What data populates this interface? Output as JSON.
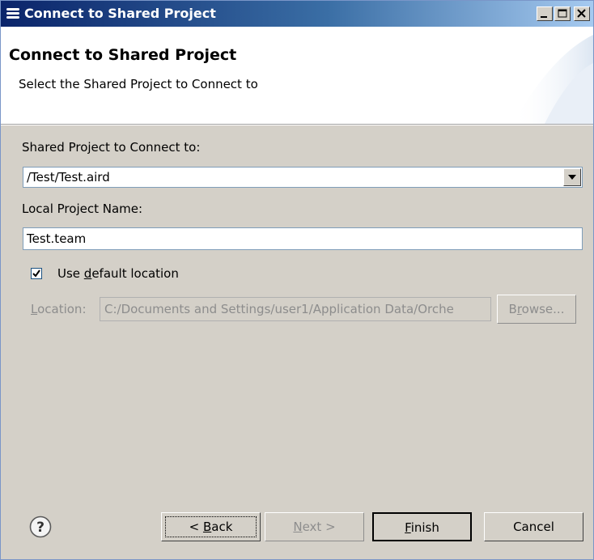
{
  "window": {
    "title": "Connect to Shared Project",
    "icon": "stacked-bars-icon"
  },
  "banner": {
    "title": "Connect to Shared Project",
    "description": "Select the Shared Project to Connect to"
  },
  "form": {
    "shared_project_label": "Shared Project to Connect to:",
    "shared_project_value": "/Test/Test.aird",
    "local_name_label": "Local Project Name:",
    "local_name_value": "Test.team",
    "use_default_checked": true,
    "use_default_pre": "Use ",
    "use_default_mn": "d",
    "use_default_post": "efault location",
    "location_label_mn": "L",
    "location_label_rest": "ocation:",
    "location_value": "C:/Documents and Settings/user1/Application Data/Orche",
    "browse_pre": "B",
    "browse_mn": "r",
    "browse_post": "owse..."
  },
  "buttons": {
    "back_pre": "< ",
    "back_mn": "B",
    "back_post": "ack",
    "next_mn": "N",
    "next_post": "ext >",
    "finish_mn": "F",
    "finish_post": "inish",
    "cancel": "Cancel"
  },
  "colors": {
    "titlebar_start": "#0a246a",
    "titlebar_end": "#a6caf0",
    "dialog_bg": "#d4d0c8",
    "disabled_text": "#8d8d8d"
  }
}
